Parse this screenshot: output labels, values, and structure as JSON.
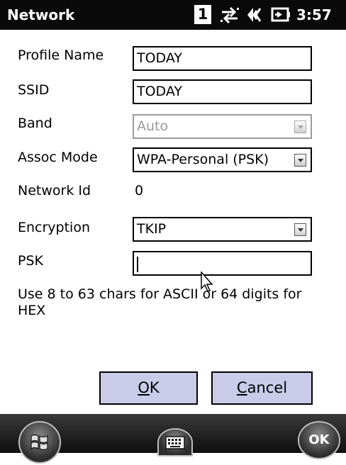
{
  "titlebar": {
    "title": "Network",
    "notification_count": "1",
    "time": "3:57",
    "icons": [
      "connectivity-arrows-icon",
      "speaker-volume-icon",
      "battery-charging-icon"
    ]
  },
  "form": {
    "profile_name": {
      "label": "Profile Name",
      "value": "TODAY"
    },
    "ssid": {
      "label": "SSID",
      "value": "TODAY"
    },
    "band": {
      "label": "Band",
      "value": "Auto"
    },
    "assoc_mode": {
      "label": "Assoc Mode",
      "value": "WPA-Personal (PSK)"
    },
    "network_id": {
      "label": "Network Id",
      "value": "0"
    },
    "encryption": {
      "label": "Encryption",
      "value": "TKIP"
    },
    "psk": {
      "label": "PSK",
      "value": ""
    },
    "hint": "Use 8 to 63 chars for ASCII or 64 digits for HEX"
  },
  "buttons": {
    "ok_hotkey": "O",
    "ok_rest": "K",
    "cancel_hotkey": "C",
    "cancel_rest": "ancel"
  },
  "taskbar": {
    "start_icon": "windows-start-icon",
    "keyboard_icon": "keyboard-icon",
    "ok_label": "OK"
  }
}
